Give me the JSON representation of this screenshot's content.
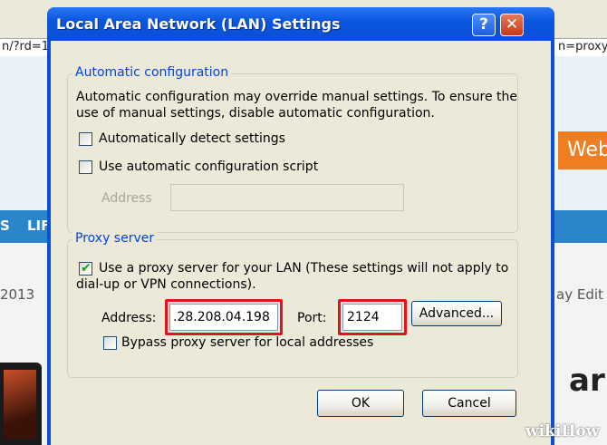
{
  "background": {
    "url_left": "n/?rd=1",
    "url_right": "n=proxy",
    "nav_items": [
      "S",
      "LIF"
    ],
    "orange_badge": "Web",
    "year_text": "2013",
    "edit_text": "ay Edit",
    "heading_fragment": "ar",
    "watermark": "wikiHow"
  },
  "dialog": {
    "title": "Local Area Network (LAN) Settings",
    "help_label": "?",
    "close_label": "✕",
    "auto_config": {
      "legend": "Automatic configuration",
      "description_line1": "Automatic configuration may override manual settings.  To ensure the",
      "description_line2": "use of manual settings, disable automatic configuration.",
      "detect_label": "Automatically detect settings",
      "detect_checked": false,
      "script_label": "Use automatic configuration script",
      "script_checked": false,
      "address_label": "Address",
      "address_value": ""
    },
    "proxy": {
      "legend": "Proxy server",
      "use_proxy_line1": "Use a proxy server for your LAN (These settings will not apply to",
      "use_proxy_line2": "dial-up or VPN connections).",
      "use_proxy_checked": true,
      "address_label": "Address:",
      "address_value": ".28.208.04.198",
      "port_label": "Port:",
      "port_value": "2124",
      "advanced_label": "Advanced...",
      "bypass_label": "Bypass proxy server for local addresses",
      "bypass_checked": false
    },
    "ok_label": "OK",
    "cancel_label": "Cancel"
  },
  "colors": {
    "title_bar": "#0a4fd6",
    "highlight": "#e0141e",
    "group_legend": "#0046d5"
  }
}
